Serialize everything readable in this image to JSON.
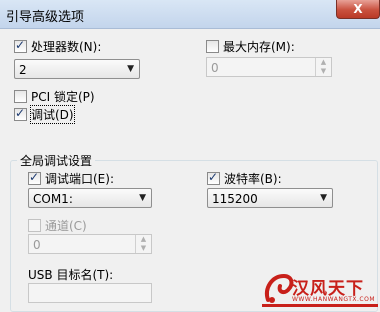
{
  "window": {
    "title": "引导高级选项",
    "close_label": "X"
  },
  "processors": {
    "label": "处理器数(N):",
    "checked": true,
    "value": "2"
  },
  "max_memory": {
    "label": "最大内存(M):",
    "checked": false,
    "value": "0"
  },
  "pci_lock": {
    "label": "PCI 锁定(P)",
    "checked": false
  },
  "debug": {
    "label": "调试(D)",
    "checked": true
  },
  "global_debug": {
    "title": "全局调试设置",
    "debug_port": {
      "label": "调试端口(E):",
      "checked": true,
      "value": "COM1:"
    },
    "baud_rate": {
      "label": "波特率(B):",
      "checked": true,
      "value": "115200"
    },
    "channel": {
      "label": "通道(C)",
      "checked": false,
      "value": "0"
    },
    "usb_target": {
      "label": "USB 目标名(T):",
      "value": ""
    }
  },
  "watermark": {
    "text": "汉风天下",
    "sub": "WWW.HANWANGTX.COM"
  },
  "colors": {
    "checkmark": "#1c3a70",
    "watermark": "#c8201a"
  }
}
